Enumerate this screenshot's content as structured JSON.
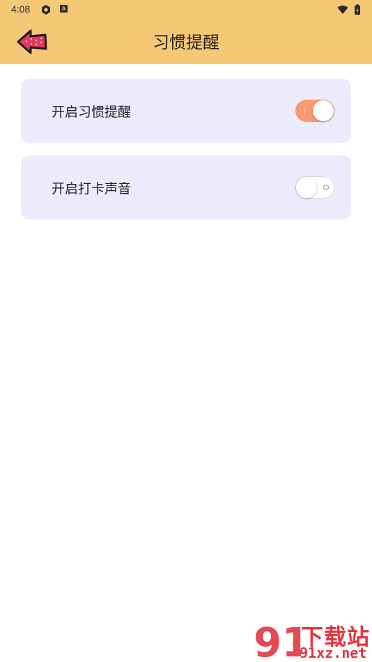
{
  "status_bar": {
    "time": "4:08",
    "letter_icon": "A",
    "icons": [
      "settings-icon",
      "a-notification-icon",
      "wifi-icon",
      "battery-icon"
    ]
  },
  "header": {
    "title": "习惯提醒",
    "back_icon": "back-arrow-icon"
  },
  "settings": [
    {
      "label": "开启习惯提醒",
      "enabled": true
    },
    {
      "label": "开启打卡声音",
      "enabled": false
    }
  ],
  "watermark": {
    "logo": "91",
    "name": "下载站",
    "domain": "91xz.net"
  },
  "colors": {
    "header_bg": "#f5c876",
    "card_bg": "#ebebfc",
    "toggle_on": "#fa9a72",
    "back_arrow": "#e8365f",
    "watermark": "#e23642"
  }
}
